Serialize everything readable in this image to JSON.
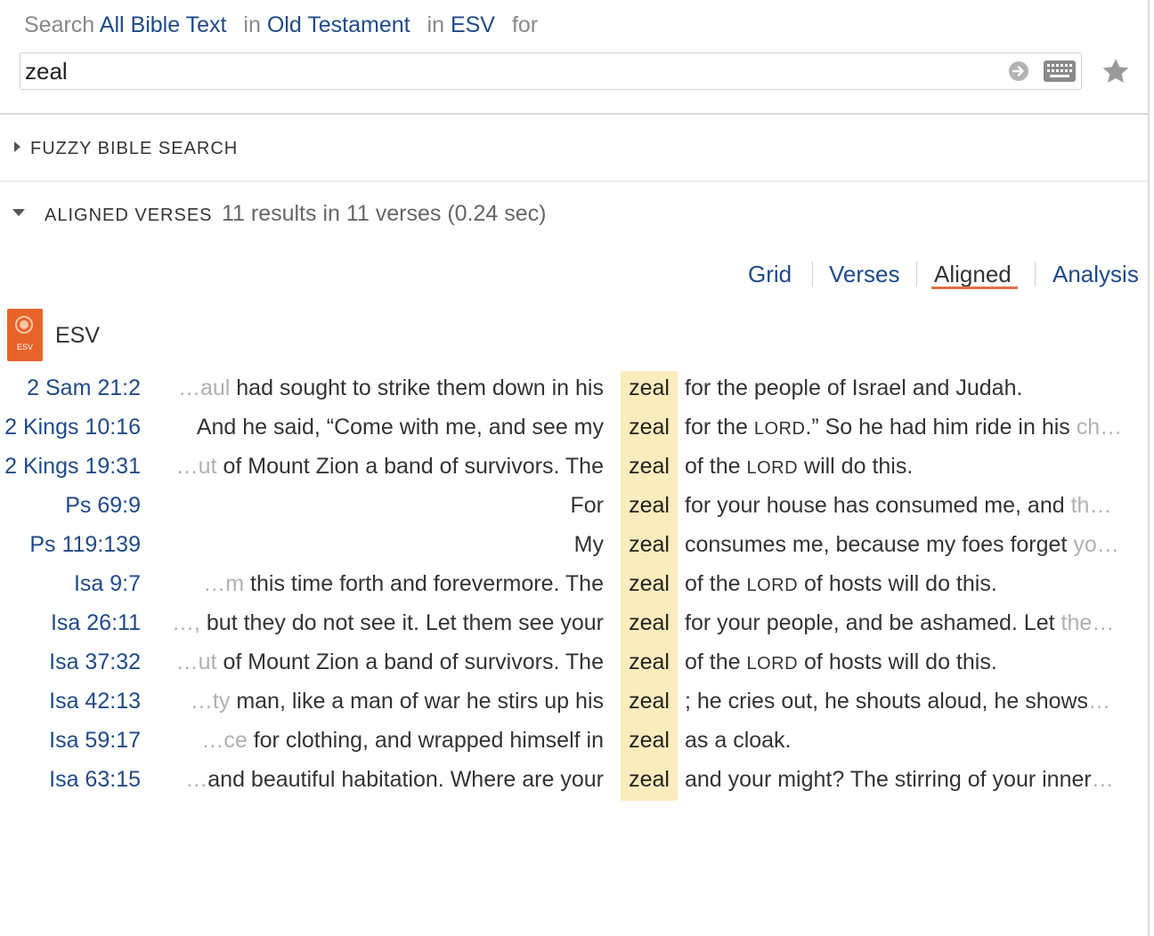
{
  "search": {
    "label_search": "Search",
    "scope": "All Bible Text",
    "label_in1": "in",
    "range": "Old Testament",
    "label_in2": "in",
    "version": "ESV",
    "label_for": "for",
    "query": "zeal"
  },
  "sections": {
    "fuzzy_title": "FUZZY BIBLE SEARCH",
    "aligned_title": "ALIGNED VERSES",
    "aligned_count": "11 results in 11 verses (0.24 sec)"
  },
  "tabs": {
    "grid": "Grid",
    "verses": "Verses",
    "aligned": "Aligned",
    "analysis": "Analysis",
    "active": "Aligned"
  },
  "bible": {
    "icon_label": "ESV",
    "name": "ESV",
    "icon_color": "#e8632a"
  },
  "highlight_color": "#fbecbd",
  "results": [
    {
      "ref": "2 Sam 21:2",
      "pre_fade": "…aul",
      "pre": " had sought to strike them down in his",
      "kw": "zeal",
      "post_html": "for the people of Israel and Judah."
    },
    {
      "ref": "2 Kings 10:16",
      "pre_fade": "",
      "pre": "And he said, “Come with me, and see my",
      "kw": "zeal",
      "post_html": "for the <span class=\"sc\">LORD</span>.” So he had him ride in his <span class=\"fade\">ch…</span>"
    },
    {
      "ref": "2 Kings 19:31",
      "pre_fade": "…ut",
      "pre": " of Mount Zion a band of survivors. The",
      "kw": "zeal",
      "post_html": "of the <span class=\"sc\">LORD</span> will do this."
    },
    {
      "ref": "Ps 69:9",
      "pre_fade": "",
      "pre": "For",
      "kw": "zeal",
      "post_html": "for your house has consumed me, and <span class=\"fade\">th…</span>"
    },
    {
      "ref": "Ps 119:139",
      "pre_fade": "",
      "pre": "My",
      "kw": "zeal",
      "post_html": "consumes me, because my foes forget <span class=\"fade\">yo…</span>"
    },
    {
      "ref": "Isa 9:7",
      "pre_fade": "…m",
      "pre": " this time forth and forevermore. The",
      "kw": "zeal",
      "post_html": "of the <span class=\"sc\">LORD</span> of hosts will do this."
    },
    {
      "ref": "Isa 26:11",
      "pre_fade": "…,",
      "pre": " but they do not see it. Let them see your",
      "kw": "zeal",
      "post_html": "for your people, and be ashamed. Let <span class=\"fade\">the…</span>"
    },
    {
      "ref": "Isa 37:32",
      "pre_fade": "…ut",
      "pre": " of Mount Zion a band of survivors. The",
      "kw": "zeal",
      "post_html": "of the <span class=\"sc\">LORD</span> of hosts will do this."
    },
    {
      "ref": "Isa 42:13",
      "pre_fade": "…ty",
      "pre": " man, like a man of war he stirs up his",
      "kw": "zeal",
      "post_html": "; he cries out, he shouts aloud, he shows<span class=\"fade\">…</span>"
    },
    {
      "ref": "Isa 59:17",
      "pre_fade": "…ce",
      "pre": " for clothing, and wrapped himself in",
      "kw": "zeal",
      "post_html": "as a cloak."
    },
    {
      "ref": "Isa 63:15",
      "pre_fade": "…",
      "pre": "and beautiful habitation. Where are your",
      "kw": "zeal",
      "post_html": "and your might? The stirring of your inner<span class=\"fade\">…</span>"
    }
  ]
}
